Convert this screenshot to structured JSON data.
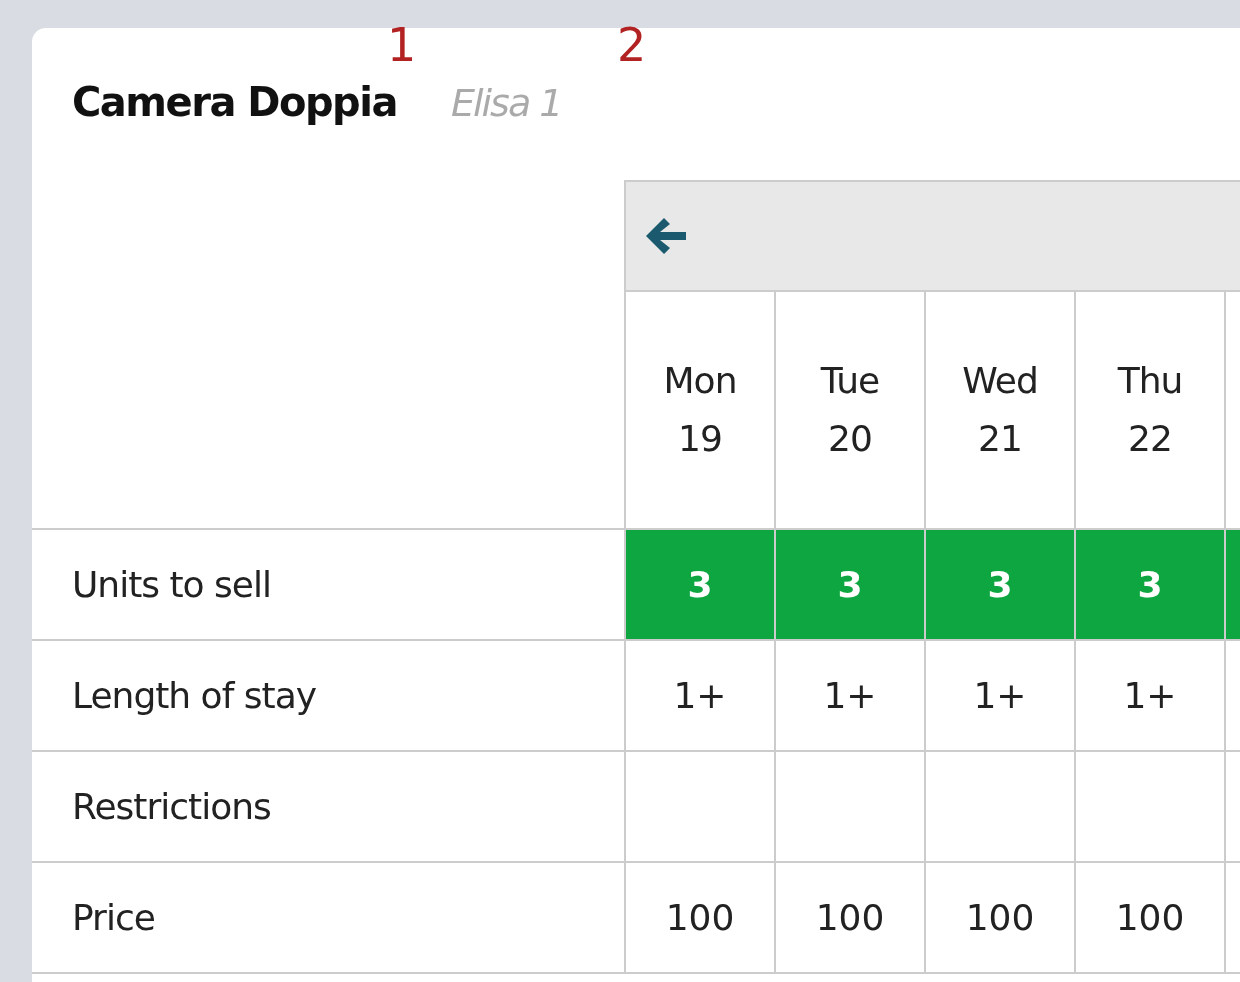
{
  "room": {
    "title": "Camera Doppia",
    "subtitle": "Elisa 1"
  },
  "annotations": [
    "1",
    "2"
  ],
  "calendar": {
    "days": [
      {
        "weekday": "Mon",
        "date": "19",
        "units": "3",
        "available": true,
        "stay": "1+",
        "price": "100"
      },
      {
        "weekday": "Tue",
        "date": "20",
        "units": "3",
        "available": true,
        "stay": "1+",
        "price": "100"
      },
      {
        "weekday": "Wed",
        "date": "21",
        "units": "3",
        "available": true,
        "stay": "1+",
        "price": "100"
      },
      {
        "weekday": "Thu",
        "date": "22",
        "units": "3",
        "available": true,
        "stay": "1+",
        "price": "100"
      },
      {
        "available": true
      }
    ],
    "rows": [
      {
        "label": "Units to sell",
        "kind": "units"
      },
      {
        "label": "Length of stay",
        "kind": "stay"
      },
      {
        "label": "Restrictions",
        "kind": "restrictions"
      },
      {
        "label": "Price",
        "kind": "price"
      }
    ]
  }
}
